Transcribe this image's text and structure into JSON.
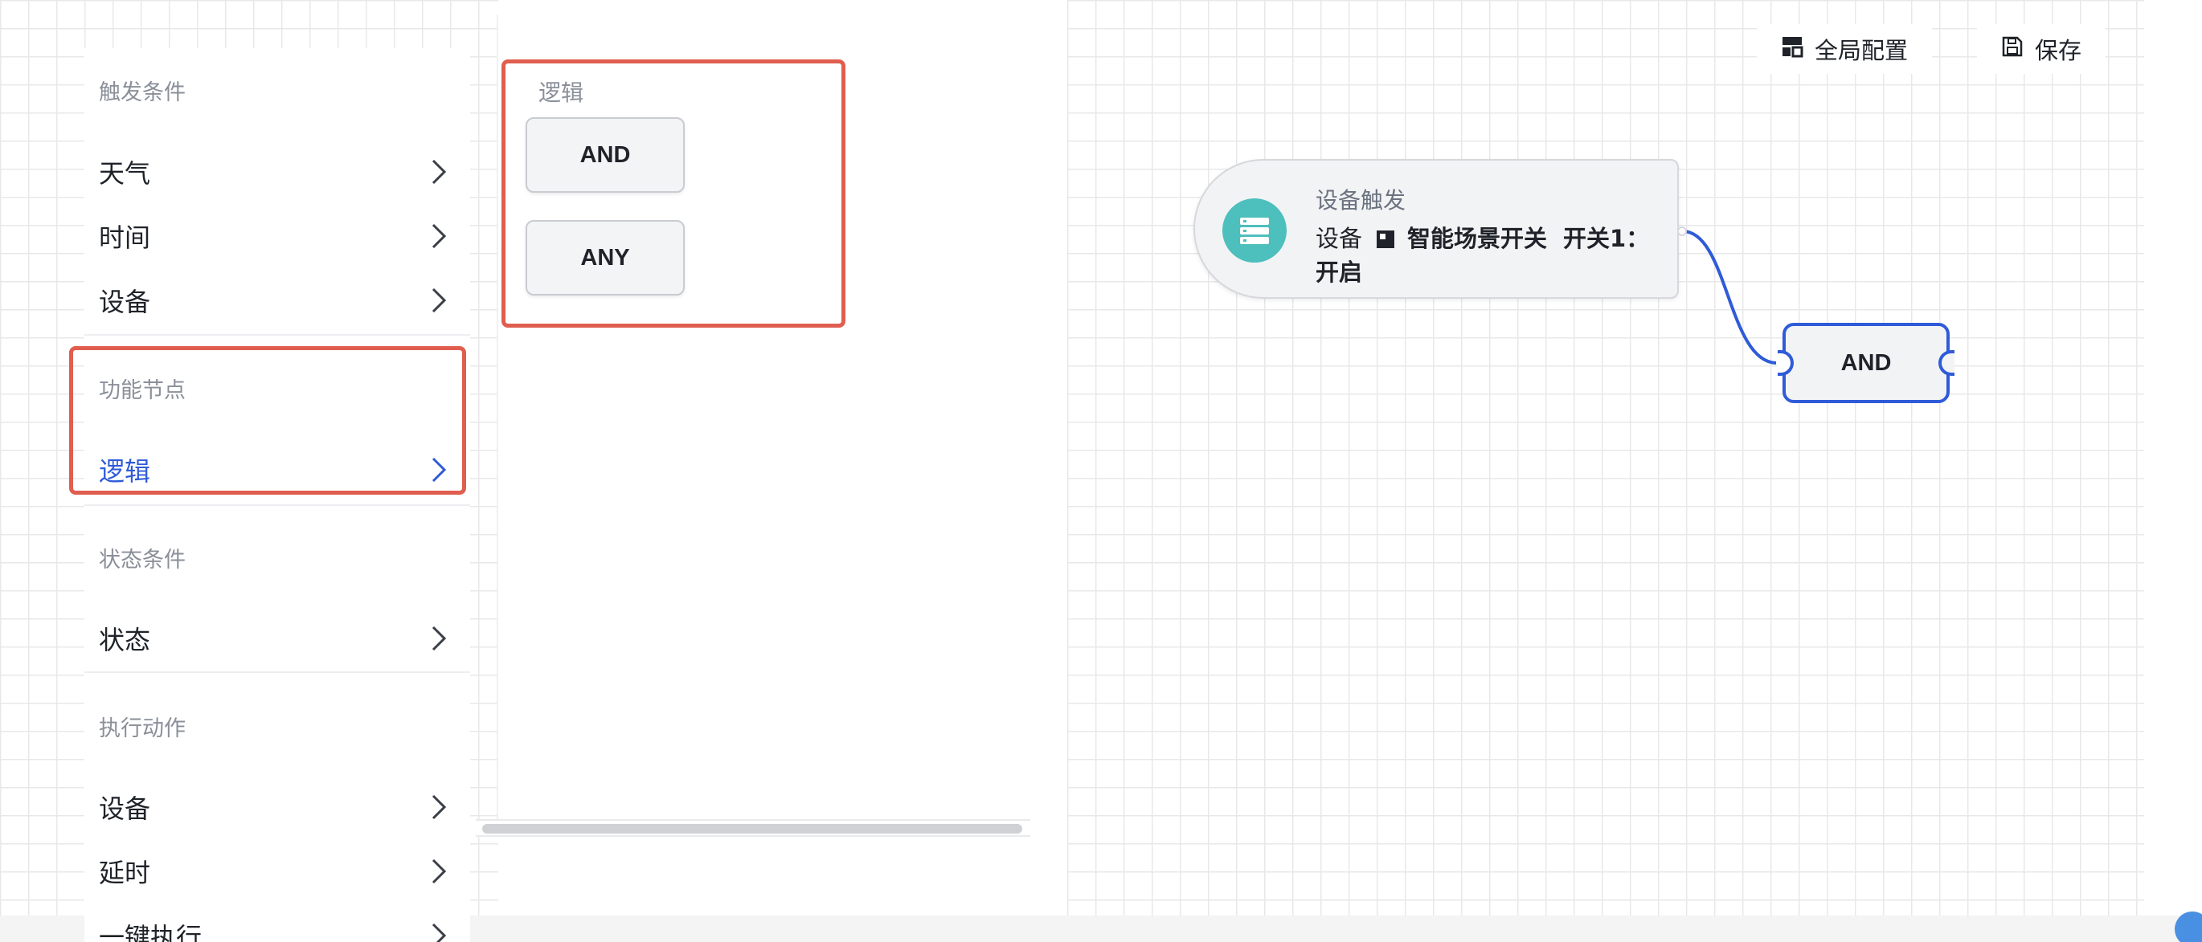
{
  "toolbar": {
    "global_config_label": "全局配置",
    "global_config_icon": "layout-icon",
    "save_label": "保存",
    "save_icon": "save-icon"
  },
  "sidebar": {
    "sections": [
      {
        "title": "触发条件",
        "items": [
          "天气",
          "时间",
          "设备"
        ]
      },
      {
        "title": "功能节点",
        "items": [
          "逻辑"
        ],
        "active": "逻辑"
      },
      {
        "title": "状态条件",
        "items": [
          "状态"
        ]
      },
      {
        "title": "执行动作",
        "items": [
          "设备",
          "延时",
          "一键执行"
        ]
      }
    ]
  },
  "palette": {
    "title": "逻辑",
    "buttons": [
      "AND",
      "ANY"
    ]
  },
  "canvas": {
    "trigger_node": {
      "title": "设备触发",
      "prefix": "设备",
      "device_name": "智能场景开关",
      "state": "开关1：",
      "state_value": "开启",
      "icon": "server-icon",
      "icon_color": "#4dbfbd"
    },
    "logic_node": {
      "label": "AND"
    }
  },
  "colors": {
    "accent": "#2f5bd8",
    "highlight": "#e05e4f"
  }
}
